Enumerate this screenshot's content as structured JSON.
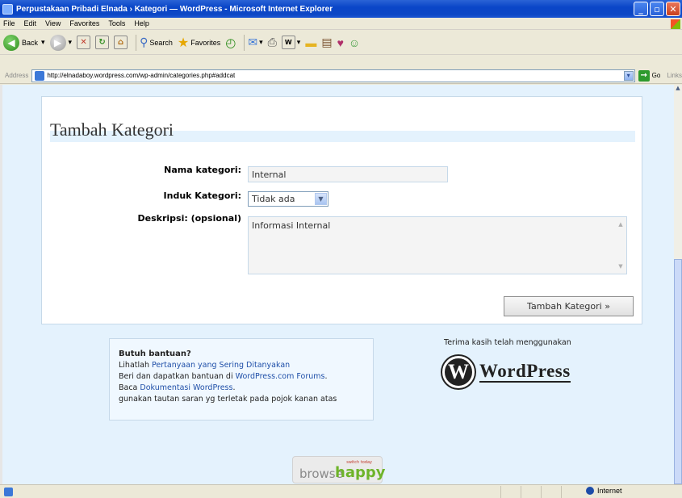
{
  "window": {
    "title": "Perpustakaan Pribadi Elnada › Kategori — WordPress - Microsoft Internet Explorer"
  },
  "menu": [
    "File",
    "Edit",
    "View",
    "Favorites",
    "Tools",
    "Help"
  ],
  "toolbar": {
    "back": "Back",
    "search": "Search",
    "favorites": "Favorites"
  },
  "address": {
    "label": "Address",
    "url": "http://elnadaboy.wordpress.com/wp-admin/categories.php#addcat",
    "go": "Go",
    "links": "Links"
  },
  "form": {
    "heading": "Tambah Kategori",
    "name_label": "Nama kategori:",
    "name_value": "Internal",
    "parent_label": "Induk Kategori:",
    "parent_value": "Tidak ada",
    "desc_label": "Deskripsi: (opsional)",
    "desc_value": "Informasi Internal",
    "submit": "Tambah Kategori »"
  },
  "help": {
    "heading": "Butuh bantuan?",
    "line1_pre": "Lihatlah ",
    "line1_link": "Pertanyaan yang Sering Ditanyakan",
    "line2_pre": "Beri dan dapatkan bantuan di ",
    "line2_link": "WordPress.com Forums",
    "line2_post": ".",
    "line3_pre": "Baca ",
    "line3_link": "Dokumentasi WordPress",
    "line3_post": ".",
    "line4": "gunakan tautan saran yg terletak pada pojok kanan atas"
  },
  "footer": {
    "thanks": "Terima kasih telah menggunakan",
    "wp_word": "WordPress",
    "browse_tag": "switch today",
    "browse_a": "browse",
    "browse_b": "happy"
  },
  "status": {
    "zone": "Internet"
  }
}
